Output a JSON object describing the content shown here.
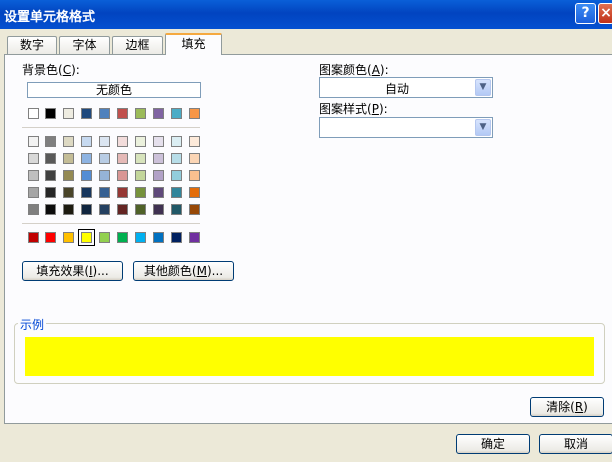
{
  "window": {
    "title": "设置单元格格式",
    "help_icon": "?",
    "close_icon": "×"
  },
  "tabs": [
    {
      "label": "数字",
      "active": false
    },
    {
      "label": "字体",
      "active": false
    },
    {
      "label": "边框",
      "active": false
    },
    {
      "label": "填充",
      "active": true
    }
  ],
  "background": {
    "label_prefix": "背景色(",
    "label_key": "C",
    "label_suffix": "):",
    "no_color": "无颜色",
    "row0": [
      "#ffffff",
      "#000000",
      "#eeece1",
      "#1f497d",
      "#4f81bd",
      "#c0504d",
      "#9bbb59",
      "#8064a2",
      "#4bacc6",
      "#f79646"
    ],
    "theme_rows": [
      [
        "#f2f2f2",
        "#7f7f7f",
        "#ddd9c3",
        "#c6d9f0",
        "#dbe5f1",
        "#f2dcdb",
        "#ebf1dd",
        "#e5e0ec",
        "#dbeef3",
        "#fdeada"
      ],
      [
        "#d8d8d8",
        "#595959",
        "#c4bd97",
        "#8db3e2",
        "#b8cce4",
        "#e5b9b7",
        "#d7e3bc",
        "#ccc1d9",
        "#b7dde8",
        "#fbd5b5"
      ],
      [
        "#bfbfbf",
        "#3f3f3f",
        "#938953",
        "#548dd4",
        "#95b3d7",
        "#d99694",
        "#c3d69b",
        "#b2a2c7",
        "#92cddc",
        "#fac08f"
      ],
      [
        "#a5a5a5",
        "#262626",
        "#494429",
        "#17365d",
        "#366092",
        "#953734",
        "#76923c",
        "#5f497a",
        "#31859b",
        "#e36c09"
      ],
      [
        "#7f7f7f",
        "#0c0c0c",
        "#1d1b10",
        "#0f243e",
        "#244061",
        "#632423",
        "#4f6128",
        "#3f3151",
        "#205867",
        "#974806"
      ]
    ],
    "standard_row": [
      "#c00000",
      "#ff0000",
      "#ffc000",
      "#ffff00",
      "#92d050",
      "#00b050",
      "#00b0f0",
      "#0070c0",
      "#002060",
      "#7030a0"
    ],
    "selected_standard_index": 3
  },
  "buttons": {
    "fill_effects_prefix": "填充效果(",
    "fill_effects_key": "I",
    "fill_effects_suffix": ")...",
    "more_colors_prefix": "其他颜色(",
    "more_colors_key": "M",
    "more_colors_suffix": ")...",
    "clear_prefix": "清除(",
    "clear_key": "R",
    "clear_suffix": ")",
    "ok": "确定",
    "cancel": "取消"
  },
  "pattern_color": {
    "label_prefix": "图案颜色(",
    "label_key": "A",
    "label_suffix": "):",
    "value": "自动"
  },
  "pattern_style": {
    "label_prefix": "图案样式(",
    "label_key": "P",
    "label_suffix": "):",
    "value": ""
  },
  "sample": {
    "label": "示例",
    "color": "#ffff00"
  }
}
